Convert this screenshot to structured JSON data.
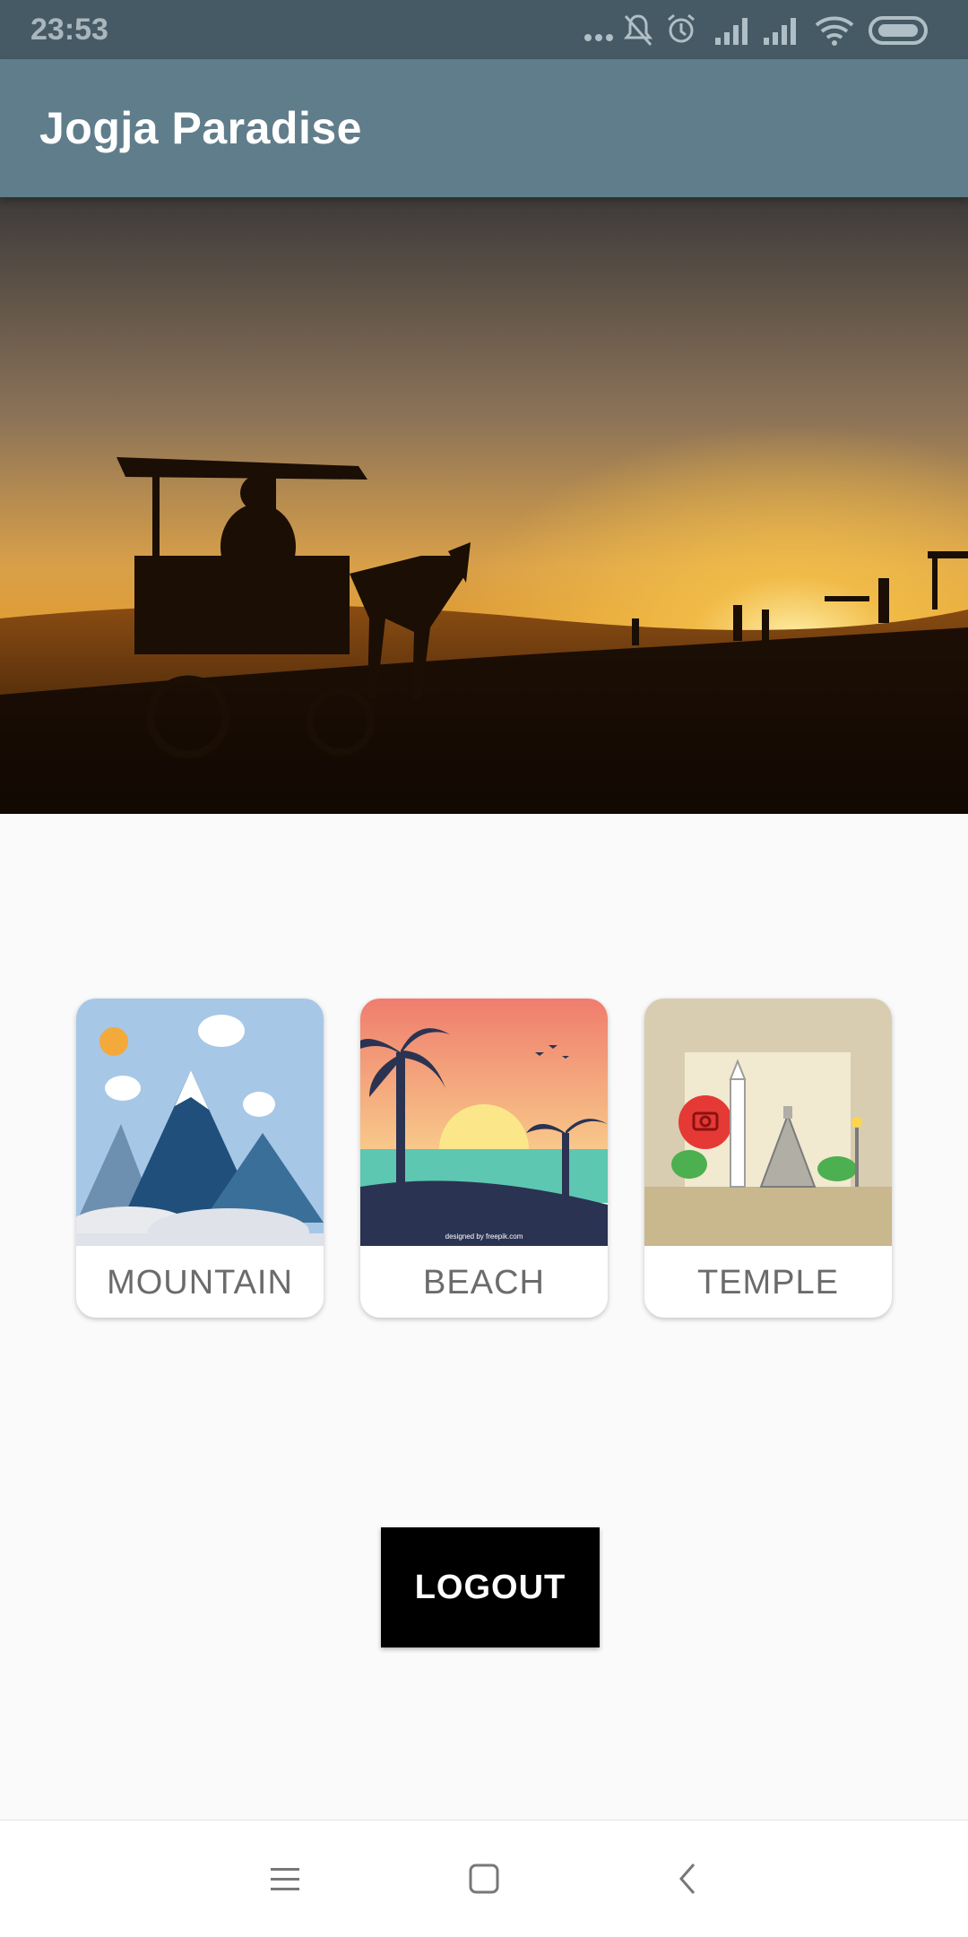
{
  "status_bar": {
    "time": "23:53",
    "icons": [
      "more-dots-icon",
      "notifications-muted-icon",
      "alarm-icon",
      "signal-icon",
      "signal-icon",
      "wifi-icon",
      "battery-icon"
    ]
  },
  "app_bar": {
    "title": "Jogja Paradise"
  },
  "carousel": {
    "slide_count": 2,
    "active_index": 0
  },
  "categories": [
    {
      "label": "MOUNTAIN",
      "art": "mountain-illustration"
    },
    {
      "label": "BEACH",
      "art": "beach-illustration",
      "credit": "designed by freepik.com"
    },
    {
      "label": "TEMPLE",
      "art": "temple-illustration"
    }
  ],
  "logout_label": "LOGOUT",
  "nav_bar": {
    "buttons": [
      "menu-icon",
      "home-icon",
      "back-icon"
    ]
  },
  "colors": {
    "status_bar": "#455a64",
    "app_bar": "#607d8b",
    "button": "#000000",
    "background": "#fafafa"
  }
}
